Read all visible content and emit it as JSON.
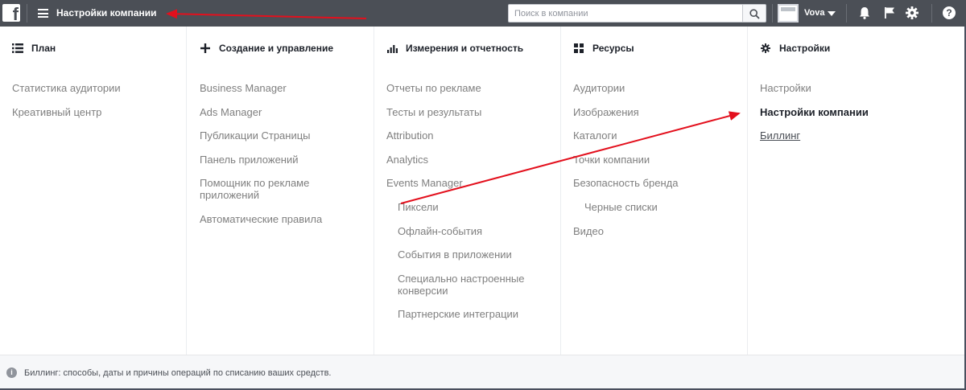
{
  "topbar": {
    "logo": "f",
    "title": "Настройки компании",
    "search_placeholder": "Поиск в компании",
    "account_name": "Vova",
    "icons": [
      "facebook-logo-icon",
      "hamburger-menu-icon",
      "search-icon",
      "account-avatar-icon",
      "chevron-down-icon",
      "bell-icon",
      "flag-icon",
      "gear-icon",
      "help-icon"
    ]
  },
  "columns": [
    {
      "heading": "План",
      "icon": "list-icon",
      "items": [
        {
          "label": "Статистика аудитории"
        },
        {
          "label": "Креативный центр"
        }
      ]
    },
    {
      "heading": "Создание и управление",
      "icon": "plus-icon",
      "items": [
        {
          "label": "Business Manager"
        },
        {
          "label": "Ads Manager"
        },
        {
          "label": "Публикации Страницы"
        },
        {
          "label": "Панель приложений"
        },
        {
          "label": "Помощник по рекламе приложений"
        },
        {
          "label": "Автоматические правила"
        }
      ]
    },
    {
      "heading": "Измерения и отчетность",
      "icon": "bar-chart-icon",
      "items": [
        {
          "label": "Отчеты по рекламе"
        },
        {
          "label": "Тесты и результаты"
        },
        {
          "label": "Attribution"
        },
        {
          "label": "Analytics"
        },
        {
          "label": "Events Manager"
        },
        {
          "label": "Пиксели"
        },
        {
          "label": "Офлайн-события"
        },
        {
          "label": "События в приложении"
        },
        {
          "label": "Специально настроенные конверсии"
        },
        {
          "label": "Партнерские интеграции"
        }
      ]
    },
    {
      "heading": "Ресурсы",
      "icon": "grid-icon",
      "items": [
        {
          "label": "Аудитории"
        },
        {
          "label": "Изображения"
        },
        {
          "label": "Каталоги"
        },
        {
          "label": "Точки компании"
        },
        {
          "label": "Безопасность бренда"
        },
        {
          "label": "Черные списки"
        },
        {
          "label": "Видео"
        }
      ]
    },
    {
      "heading": "Настройки",
      "icon": "gear-icon",
      "items": [
        {
          "label": "Настройки"
        },
        {
          "label": "Настройки компании"
        },
        {
          "label": "Биллинг"
        }
      ]
    }
  ],
  "footer": {
    "text": "Биллинг: способы, даты и причины операций по списанию ваших средств."
  },
  "colors": {
    "topbar_bg": "#4b4f56",
    "annotation_red": "#e3101d",
    "item_text": "#7f7f7f",
    "heading_text": "#1d2129"
  }
}
